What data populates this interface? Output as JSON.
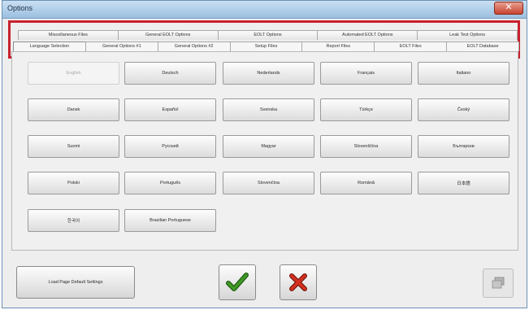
{
  "window": {
    "title": "Options",
    "close_label": "✕"
  },
  "tabs": {
    "back_row": [
      {
        "label": "Miscellaneous Files"
      },
      {
        "label": "General EOLT Options"
      },
      {
        "label": "EOLT Options"
      },
      {
        "label": "Automated EOLT Options"
      },
      {
        "label": "Leak Test Options"
      }
    ],
    "front_row": [
      {
        "label": "Language Selection",
        "selected": true
      },
      {
        "label": "General Options #1"
      },
      {
        "label": "General Options #2"
      },
      {
        "label": "Setup Files"
      },
      {
        "label": "Report Files"
      },
      {
        "label": "EOLT Files"
      },
      {
        "label": "EOLT Database"
      }
    ]
  },
  "languages": [
    {
      "label": "English",
      "selected": true
    },
    {
      "label": "Deutsch"
    },
    {
      "label": "Nederlands"
    },
    {
      "label": "Français"
    },
    {
      "label": "Italiano"
    },
    {
      "label": "Dansk"
    },
    {
      "label": "Español"
    },
    {
      "label": "Svenska"
    },
    {
      "label": "Türkçe"
    },
    {
      "label": "Český"
    },
    {
      "label": "Suomi"
    },
    {
      "label": "Русский"
    },
    {
      "label": "Magyar"
    },
    {
      "label": "Slovenščina"
    },
    {
      "label": "Български"
    },
    {
      "label": "Polski"
    },
    {
      "label": "Português"
    },
    {
      "label": "Slovenčina"
    },
    {
      "label": "Română"
    },
    {
      "label": "日本語"
    },
    {
      "label": "한국어"
    },
    {
      "label": "Brazilian Portuguese"
    }
  ],
  "footer": {
    "load_defaults_label": "Load Page Default Settings",
    "ok_icon": "checkmark-icon",
    "cancel_icon": "cross-icon",
    "aux_icon": "stack-icon"
  },
  "colors": {
    "highlight": "#c8202e",
    "ok_green": "#2e7d1e",
    "cancel_red": "#c42a1c"
  }
}
